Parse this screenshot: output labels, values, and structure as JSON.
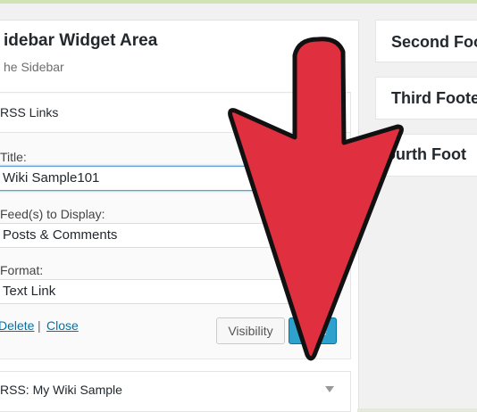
{
  "sidebar_area": {
    "title": "idebar Widget Area",
    "description": "he Sidebar"
  },
  "widget": {
    "header": "RSS Links",
    "fields": [
      {
        "label": "Title:",
        "value": "Wiki Sample101"
      },
      {
        "label": "Feed(s) to Display:",
        "value": "Posts & Comments"
      },
      {
        "label": "Format:",
        "value": "Text Link"
      }
    ],
    "links": {
      "delete": "Delete",
      "separator": "|",
      "close": "Close"
    },
    "buttons": {
      "visibility": "Visibility",
      "save": "Save"
    }
  },
  "second_widget": {
    "prefix": "RSS:",
    "name": "My Wiki Sample",
    "caret_icon": "caret-down-icon"
  },
  "footer_areas": [
    {
      "label": "Second Foot"
    },
    {
      "label": "Third Foote"
    },
    {
      "label": "ourth Foot"
    }
  ],
  "overlay": {
    "icon": "down-arrow-icon",
    "color": "#e03040"
  },
  "colors": {
    "accent": "#2ea2cc",
    "link": "#0073aa",
    "focus_border": "#5b9dd9"
  }
}
